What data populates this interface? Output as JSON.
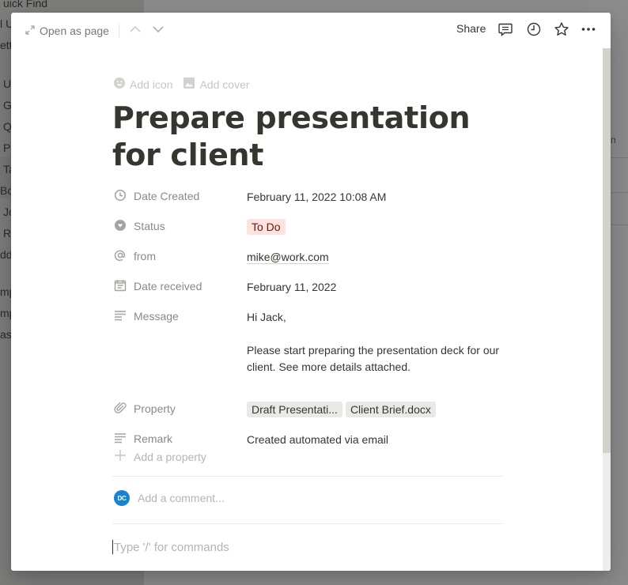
{
  "background": {
    "sidebar_fragments": [
      "uick Find",
      "l U",
      "etti",
      "U",
      "G",
      "Q",
      "Pe",
      "Ta",
      "Bo",
      "Jo",
      "Re",
      "dd",
      "mp",
      "mpo",
      "ash"
    ],
    "main_fragment": "n"
  },
  "topbar": {
    "open_as_page": "Open as page",
    "share": "Share",
    "icons": [
      "expand-icon",
      "chevron-up-icon",
      "chevron-down-icon",
      "comment-icon",
      "clock-icon",
      "star-icon",
      "more-icon"
    ]
  },
  "page_controls": {
    "add_icon": "Add icon",
    "add_cover": "Add cover"
  },
  "title": "Prepare presentation for client",
  "properties": [
    {
      "icon": "clock-icon",
      "name": "Date Created",
      "value": "February 11, 2022 10:08 AM"
    },
    {
      "icon": "select-icon",
      "name": "Status",
      "value": "To Do"
    },
    {
      "icon": "at-icon",
      "name": "from",
      "value": "mike@work.com"
    },
    {
      "icon": "calendar-icon",
      "name": "Date received",
      "value": "February 11, 2022"
    },
    {
      "icon": "text-icon",
      "name": "Message",
      "value_lines": [
        "Hi Jack,",
        "",
        "Please start preparing the presentation deck for our client. See more details attached."
      ]
    },
    {
      "icon": "paperclip-icon",
      "name": "Property",
      "files": [
        "Draft Presentati...",
        "Client Brief.docx"
      ]
    },
    {
      "icon": "text-icon",
      "name": "Remark",
      "value": "Created automated via email"
    }
  ],
  "add_property": "Add a property",
  "comment": {
    "avatar_initials": "DC",
    "placeholder": "Add a comment..."
  },
  "editor_placeholder": "Type '/' for commands",
  "colors": {
    "status_todo_bg": "#ffe2dd",
    "status_todo_text": "#5d1715",
    "avatar_bg": "#1583cf"
  }
}
